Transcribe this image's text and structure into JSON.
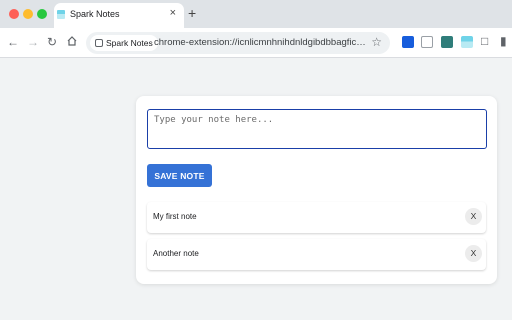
{
  "browser": {
    "tab": {
      "title": "Spark Notes",
      "close_label": "×",
      "favicon": "notepad-icon"
    },
    "new_tab_label": "+",
    "site_chip_label": "Spark Notes",
    "url": "chrome-extension://icnlicmnhnihdnldgibdbbagficoomc...",
    "extensions": [
      "bitwarden-icon",
      "reader-icon",
      "extension-icon",
      "spark-notes-icon",
      "puzzle-icon",
      "sidebar-icon"
    ]
  },
  "popup": {
    "input": {
      "placeholder": "Type your note here...",
      "value": ""
    },
    "save_label": "SAVE NOTE",
    "notes": [
      {
        "text": "My first note",
        "delete_label": "X"
      },
      {
        "text": "Another note",
        "delete_label": "X"
      }
    ]
  },
  "colors": {
    "accent": "#3572d6",
    "input_border": "#1a3fa8",
    "background": "#f1f3f4"
  }
}
